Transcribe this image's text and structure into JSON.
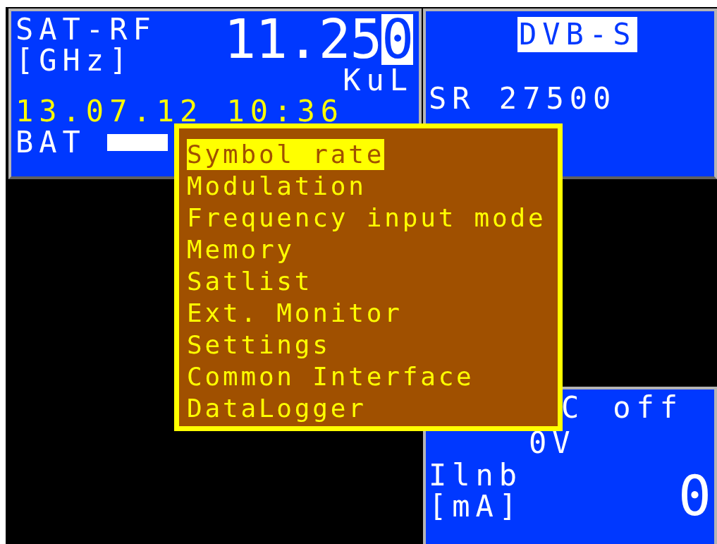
{
  "rf_panel": {
    "label": "SAT-RF",
    "unit": "[GHz]",
    "frequency_digits": [
      {
        "text": "11.25",
        "selected": false
      },
      {
        "text": "0",
        "selected": true
      }
    ],
    "band": "KuL",
    "datetime": "13.07.12 10:36",
    "battery_label": "BAT"
  },
  "signal_panel": {
    "standard": "DVB-S",
    "symbol_rate": "SR 27500"
  },
  "lnb_panel": {
    "setting_label": "C",
    "setting_value": "off",
    "voltage": "0V",
    "current_label": "Ilnb",
    "current_unit": "[mA]",
    "current_value": "0"
  },
  "menu": {
    "items": [
      {
        "label": "Symbol rate",
        "selected": true
      },
      {
        "label": "Modulation",
        "selected": false
      },
      {
        "label": "Frequency input mode",
        "selected": false
      },
      {
        "label": "Memory",
        "selected": false
      },
      {
        "label": "Satlist",
        "selected": false
      },
      {
        "label": "Ext. Monitor",
        "selected": false
      },
      {
        "label": "Settings",
        "selected": false
      },
      {
        "label": "Common Interface",
        "selected": false
      },
      {
        "label": "DataLogger",
        "selected": false
      }
    ]
  }
}
